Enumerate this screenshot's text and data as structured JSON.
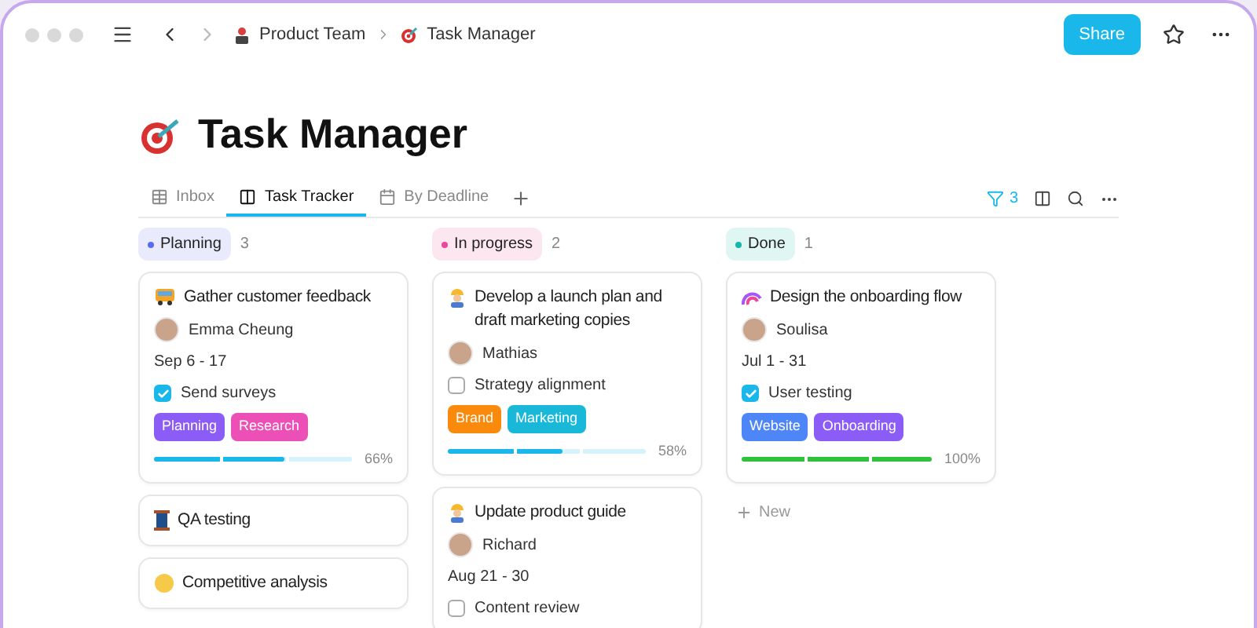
{
  "breadcrumbs": [
    {
      "label": "Product Team",
      "kind": "team"
    },
    {
      "label": "Task Manager",
      "kind": "target"
    }
  ],
  "share_button": "Share",
  "page_title": "Task Manager",
  "tabs": [
    {
      "label": "Inbox",
      "kind": "table",
      "selected": false
    },
    {
      "label": "Task Tracker",
      "kind": "board",
      "selected": true
    },
    {
      "label": "By Deadline",
      "kind": "calendar",
      "selected": false
    }
  ],
  "filter_count": "3",
  "columns": [
    {
      "title": "Planning",
      "count": "3",
      "color": "#5b6cf0",
      "cards": [
        {
          "kind": "bus",
          "title": "Gather customer feedback",
          "assignee": "Emma Cheung",
          "dates": "Sep 6 - 17",
          "todo": {
            "label": "Send surveys",
            "checked": true
          },
          "tags": [
            {
              "label": "Planning",
              "color": "#8b5cf6"
            },
            {
              "label": "Research",
              "color": "#ec4fb5"
            }
          ],
          "level": 0.66,
          "percent": "66%"
        },
        {
          "kind": "spool",
          "title": "QA testing"
        },
        {
          "kind": "face",
          "title": "Competitive analysis"
        }
      ]
    },
    {
      "title": "In progress",
      "count": "2",
      "color": "#ec4899",
      "cards": [
        {
          "kind": "worker",
          "title": "Develop a launch plan and draft marketing copies",
          "assignee": "Mathias",
          "todo": {
            "label": "Strategy alignment",
            "checked": false
          },
          "tags": [
            {
              "label": "Brand",
              "color": "#f98a0b"
            },
            {
              "label": "Marketing",
              "color": "#1ab8d8"
            }
          ],
          "level": 0.58,
          "percent": "58%"
        },
        {
          "kind": "worker",
          "title": "Update product guide",
          "assignee": "Richard",
          "dates": "Aug 21 - 30",
          "todo": {
            "label": "Content review",
            "checked": false
          }
        }
      ]
    },
    {
      "title": "Done",
      "count": "1",
      "color": "#14b8a6",
      "new_label": "New",
      "cards": [
        {
          "kind": "rainbow",
          "title": "Design the onboarding flow",
          "assignee": "Soulisa",
          "dates": "Jul 1 - 31",
          "todo": {
            "label": "User testing",
            "checked": true
          },
          "tags": [
            {
              "label": "Website",
              "color": "#4f86f7"
            },
            {
              "label": "Onboarding",
              "color": "#8b5cf6"
            }
          ],
          "level": 1,
          "percent": "100%"
        }
      ]
    }
  ]
}
